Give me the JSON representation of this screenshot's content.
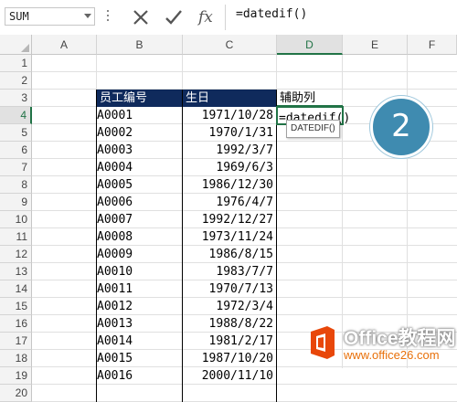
{
  "formula_bar": {
    "name_box": "SUM",
    "formula": "=datedif()",
    "fx_label": "fx"
  },
  "columns": [
    "A",
    "B",
    "C",
    "D",
    "E",
    "F"
  ],
  "active_column": "D",
  "rows": [
    "1",
    "2",
    "3",
    "4",
    "5",
    "6",
    "7",
    "8",
    "9",
    "10",
    "11",
    "12",
    "13",
    "14",
    "15",
    "16",
    "17",
    "18",
    "19",
    "20"
  ],
  "active_row": "4",
  "table": {
    "header_id": "员工编号",
    "header_birth": "生日",
    "helper_header": "辅助列",
    "active_cell_text": "=datedif()",
    "records": [
      {
        "id": "A0001",
        "birth": "1971/10/28"
      },
      {
        "id": "A0002",
        "birth": "1970/1/31"
      },
      {
        "id": "A0003",
        "birth": "1992/3/7"
      },
      {
        "id": "A0004",
        "birth": "1969/6/3"
      },
      {
        "id": "A0005",
        "birth": "1986/12/30"
      },
      {
        "id": "A0006",
        "birth": "1976/4/7"
      },
      {
        "id": "A0007",
        "birth": "1992/12/27"
      },
      {
        "id": "A0008",
        "birth": "1973/11/24"
      },
      {
        "id": "A0009",
        "birth": "1986/8/15"
      },
      {
        "id": "A0010",
        "birth": "1983/7/7"
      },
      {
        "id": "A0011",
        "birth": "1970/7/13"
      },
      {
        "id": "A0012",
        "birth": "1972/3/4"
      },
      {
        "id": "A0013",
        "birth": "1988/8/22"
      },
      {
        "id": "A0014",
        "birth": "1981/2/17"
      },
      {
        "id": "A0015",
        "birth": "1987/10/20"
      },
      {
        "id": "A0016",
        "birth": "2000/11/10"
      }
    ]
  },
  "tooltip": "DATEDIF()",
  "step_badge": "2",
  "watermark": {
    "title": "Office教程网",
    "url": "www.office26.com"
  },
  "colors": {
    "header_fill": "#0f2a5c",
    "excel_green": "#217346",
    "badge": "#3f8bb0",
    "watermark_orange": "#e8700a"
  }
}
